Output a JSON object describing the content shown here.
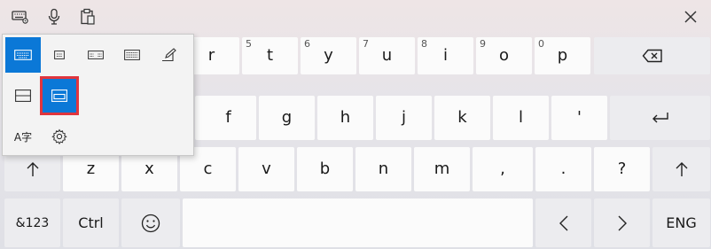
{
  "topbar": {
    "icons": [
      "keyboard-settings-icon",
      "microphone-icon",
      "clipboard-icon",
      "close-icon"
    ]
  },
  "rows": {
    "r1": [
      {
        "label": "r",
        "sec": ""
      },
      {
        "label": "t",
        "sec": "5"
      },
      {
        "label": "y",
        "sec": "6"
      },
      {
        "label": "u",
        "sec": "7"
      },
      {
        "label": "i",
        "sec": "8"
      },
      {
        "label": "o",
        "sec": "9"
      },
      {
        "label": "p",
        "sec": "0"
      }
    ],
    "r2": [
      "f",
      "g",
      "h",
      "j",
      "k",
      "l",
      "'"
    ],
    "r3": [
      "z",
      "x",
      "c",
      "v",
      "b",
      "n",
      "m",
      ",",
      ".",
      "?"
    ],
    "r4": {
      "num": "&123",
      "ctrl": "Ctrl",
      "lang": "ENG"
    }
  },
  "popup": {
    "layout_icons": [
      "default-keyboard-icon",
      "small-keyboard-icon",
      "split-keyboard-icon",
      "traditional-keyboard-icon",
      "handwriting-icon"
    ],
    "dock_icons": [
      "docked-keyboard-icon",
      "undocked-keyboard-icon"
    ],
    "ime_label": "A字",
    "settings_icon": "settings-gear-icon"
  },
  "colors": {
    "accent": "#0b78d7",
    "focus_outline": "#e0353d",
    "key_bg": "#fbfbfb"
  }
}
